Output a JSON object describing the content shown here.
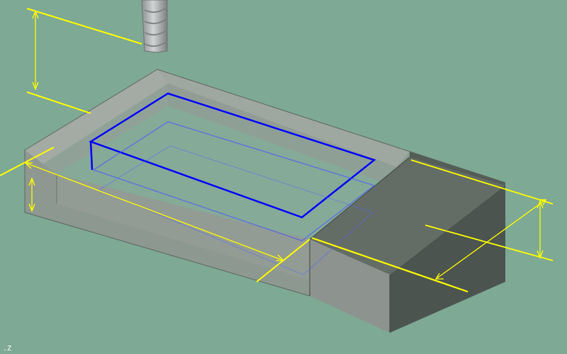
{
  "viewport": {
    "background": "#7ea995",
    "axis_indicator": ".Z"
  },
  "colors": {
    "dimension": "#ffff00",
    "toolpath": "#0000ff",
    "toolpath_faint": "#5566ff",
    "stock_side": "#8f9690",
    "stock_top": "#a0a6a0",
    "pocket_floor": "#8aa89a",
    "step_block": "#5a625c",
    "tool": "#b9bcbc"
  },
  "scene": {
    "objects": [
      {
        "name": "end-mill-tool",
        "kind": "tool"
      },
      {
        "name": "stock-block",
        "kind": "transparent-solid"
      },
      {
        "name": "step-block",
        "kind": "solid"
      },
      {
        "name": "pocket-toolpath",
        "kind": "toolpath"
      },
      {
        "name": "dimension-lines",
        "kind": "annotation"
      }
    ]
  }
}
